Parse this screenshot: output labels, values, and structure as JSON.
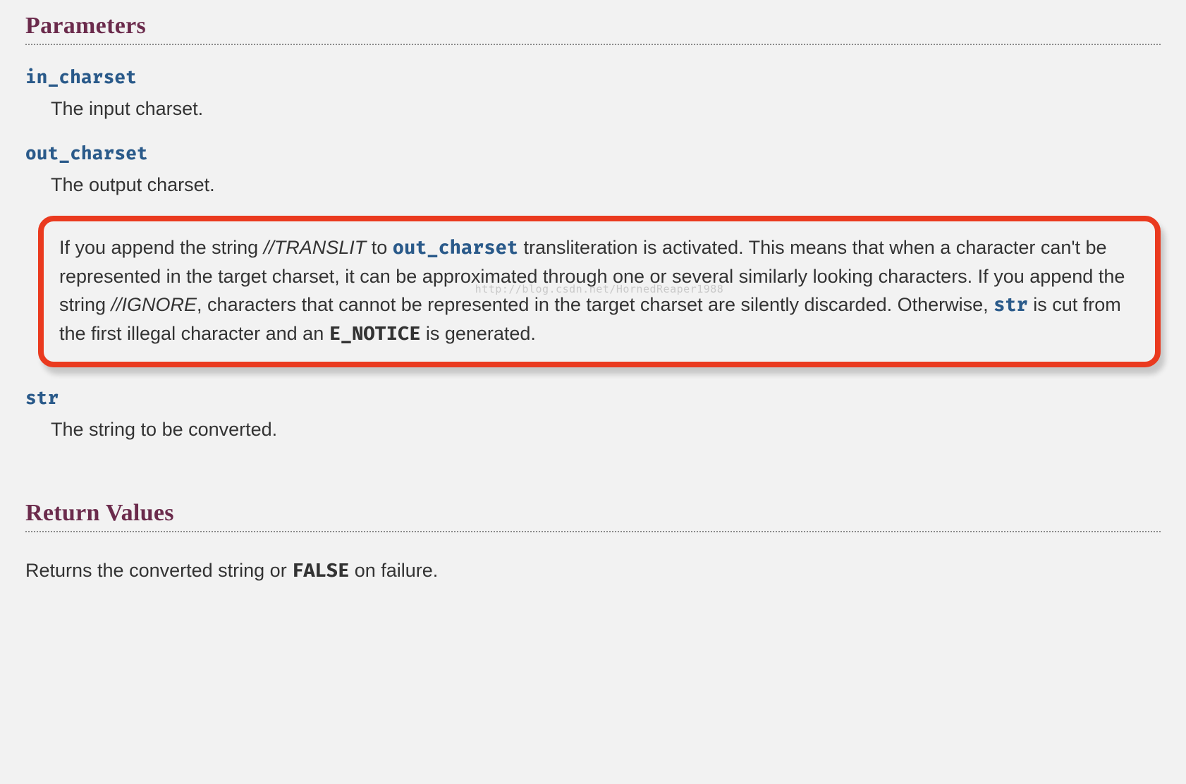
{
  "sections": {
    "parameters": {
      "heading": "Parameters",
      "in_charset": {
        "name": "in_charset",
        "desc": "The input charset."
      },
      "out_charset": {
        "name": "out_charset",
        "desc": "The output charset.",
        "highlight": {
          "p1a": "If you append the string ",
          "translit": "//TRANSLIT",
          "p1b": " to ",
          "out_charset_ref": "out_charset",
          "p1c": " transliteration is activated. This means that when a character can't be represented in the target charset, it can be approximated through one or several similarly looking characters. If you append the string ",
          "ignore": "//IGNORE",
          "p1d": ", characters that cannot be represented in the target charset are silently discarded. Otherwise, ",
          "str_ref": "str",
          "p1e": " is cut from the first illegal character and an ",
          "e_notice": "E_NOTICE",
          "p1f": " is generated."
        }
      },
      "str": {
        "name": "str",
        "desc": "The string to be converted."
      }
    },
    "return_values": {
      "heading": "Return Values",
      "desc_a": "Returns the converted string or ",
      "false": "FALSE",
      "desc_b": " on failure."
    }
  },
  "watermark": "http://blog.csdn.net/HornedReaper1988"
}
